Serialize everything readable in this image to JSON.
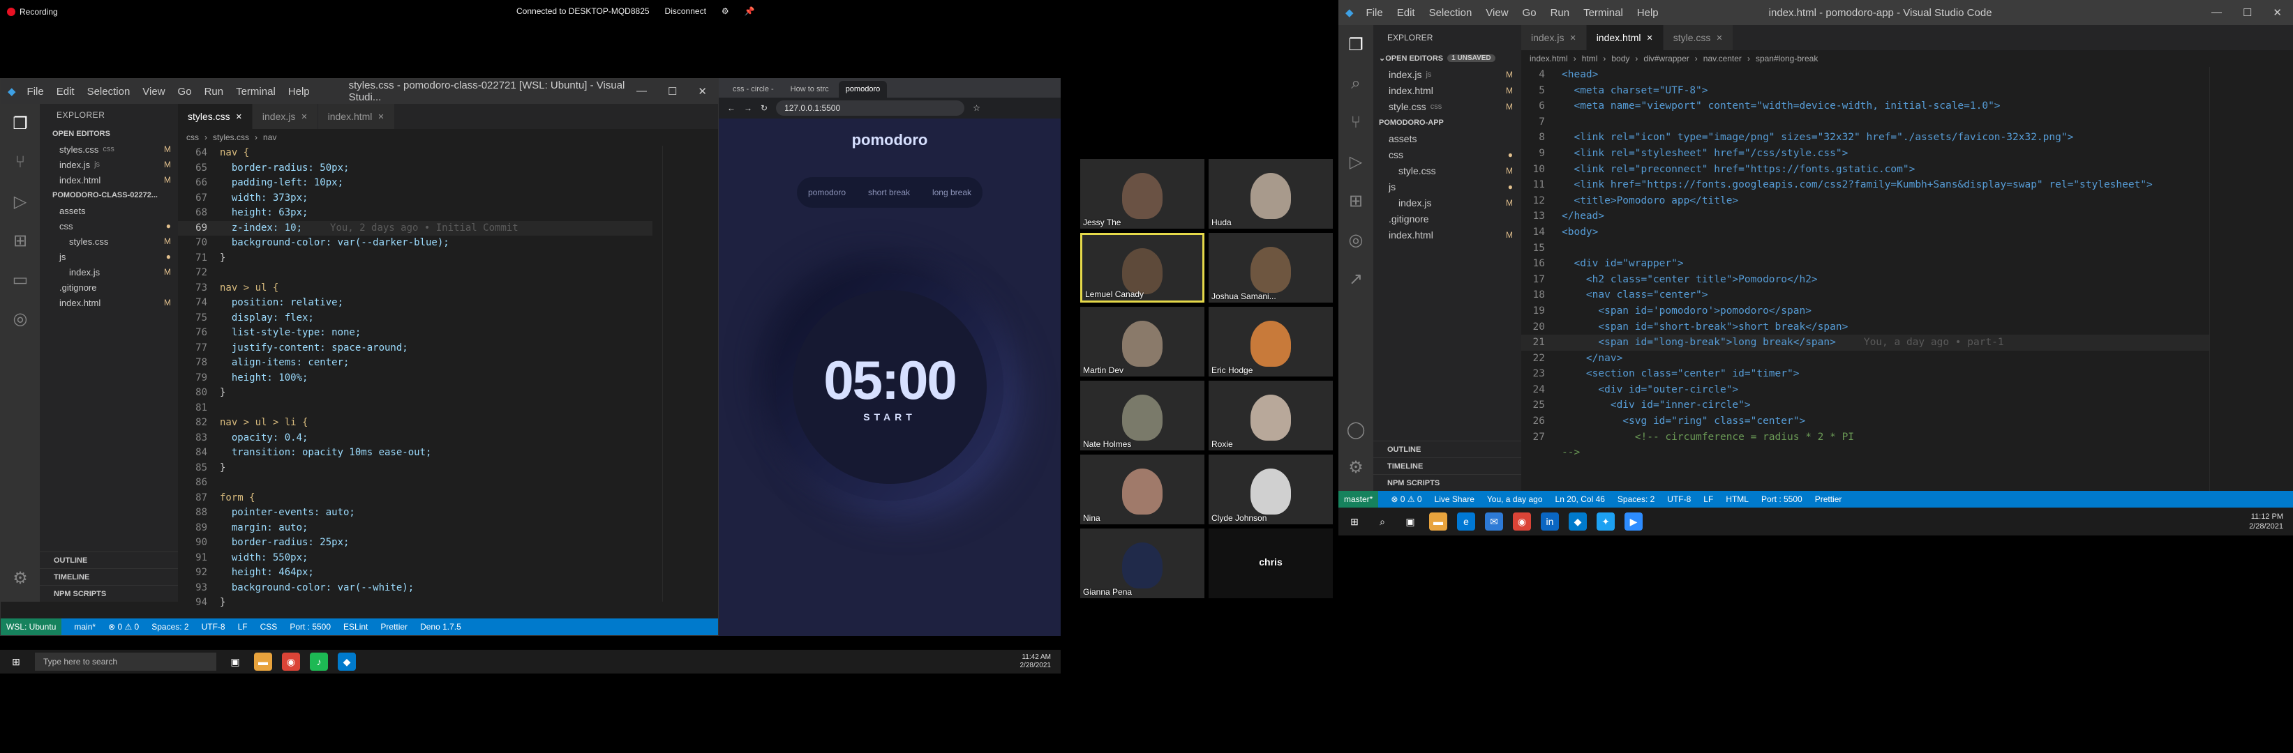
{
  "top": {
    "recording": "Recording",
    "connected": "Connected to DESKTOP-MQD8825",
    "disconnect": "Disconnect"
  },
  "left_vscode": {
    "menu": [
      "File",
      "Edit",
      "Selection",
      "View",
      "Go",
      "Run",
      "Terminal",
      "Help"
    ],
    "title": "styles.css - pomodoro-class-022721 [WSL: Ubuntu] - Visual Studi...",
    "explorer": "EXPLORER",
    "open_editors": "OPEN EDITORS",
    "open_files": [
      {
        "name": "styles.css",
        "path": "css",
        "status": "M"
      },
      {
        "name": "index.js",
        "path": "js",
        "status": "M"
      },
      {
        "name": "index.html",
        "path": "",
        "status": "M"
      }
    ],
    "project": "POMODORO-CLASS-02272...",
    "tree": [
      {
        "name": "assets",
        "status": ""
      },
      {
        "name": "css",
        "status": "●"
      },
      {
        "name": "styles.css",
        "status": "M"
      },
      {
        "name": "js",
        "status": "●"
      },
      {
        "name": "index.js",
        "status": "M"
      },
      {
        "name": ".gitignore",
        "status": ""
      },
      {
        "name": "index.html",
        "status": "M"
      }
    ],
    "bottom_sections": [
      "OUTLINE",
      "TIMELINE",
      "NPM SCRIPTS"
    ],
    "tabs": [
      "styles.css",
      "index.js",
      "index.html"
    ],
    "breadcrumb": [
      "css",
      "styles.css",
      "nav"
    ],
    "lines": [
      [
        "64",
        "nav {"
      ],
      [
        "65",
        "  border-radius: 50px;"
      ],
      [
        "66",
        "  padding-left: 10px;"
      ],
      [
        "67",
        "  width: 373px;"
      ],
      [
        "68",
        "  height: 63px;"
      ],
      [
        "69",
        "  z-index: 10;"
      ],
      [
        "70",
        "  background-color: var(--darker-blue);"
      ],
      [
        "71",
        "}"
      ],
      [
        "72",
        ""
      ],
      [
        "73",
        "nav > ul {"
      ],
      [
        "74",
        "  position: relative;"
      ],
      [
        "75",
        "  display: flex;"
      ],
      [
        "76",
        "  list-style-type: none;"
      ],
      [
        "77",
        "  justify-content: space-around;"
      ],
      [
        "78",
        "  align-items: center;"
      ],
      [
        "79",
        "  height: 100%;"
      ],
      [
        "80",
        "}"
      ],
      [
        "81",
        ""
      ],
      [
        "82",
        "nav > ul > li {"
      ],
      [
        "83",
        "  opacity: 0.4;"
      ],
      [
        "84",
        "  transition: opacity 10ms ease-out;"
      ],
      [
        "85",
        "}"
      ],
      [
        "86",
        ""
      ],
      [
        "87",
        "form {"
      ],
      [
        "88",
        "  pointer-events: auto;"
      ],
      [
        "89",
        "  margin: auto;"
      ],
      [
        "90",
        "  border-radius: 25px;"
      ],
      [
        "91",
        "  width: 550px;"
      ],
      [
        "92",
        "  height: 464px;"
      ],
      [
        "93",
        "  background-color: var(--white);"
      ],
      [
        "94",
        "}"
      ]
    ],
    "blame": "You, 2 days ago • Initial Commit",
    "status": [
      "WSL: Ubuntu",
      "main*",
      "⊗ 0 ⚠ 0",
      "Spaces: 2",
      "UTF-8",
      "LF",
      "CSS",
      "Port : 5500",
      "ESLint",
      "Prettier",
      "Deno 1.7.5"
    ]
  },
  "browser": {
    "tabs": [
      "css - circle -",
      "How to strc",
      "pomodoro"
    ],
    "url": "127.0.0.1:5500",
    "app_title": "pomodoro",
    "nav": [
      "pomodoro",
      "short break",
      "long break"
    ],
    "time": "05:00",
    "start": "START"
  },
  "participants": [
    "Jessy The",
    "Huda",
    "Lemuel Canady",
    "Joshua Samani...",
    "Martin Dev",
    "Eric Hodge",
    "Nate Holmes",
    "Roxie",
    "Nina",
    "Clyde Johnson",
    "Gianna Pena",
    "chris"
  ],
  "right_vscode": {
    "menu": [
      "File",
      "Edit",
      "Selection",
      "View",
      "Go",
      "Run",
      "Terminal",
      "Help"
    ],
    "title": "index.html - pomodoro-app - Visual Studio Code",
    "explorer": "EXPLORER",
    "open_editors": "OPEN EDITORS",
    "unsaved": "1 UNSAVED",
    "open_files": [
      {
        "name": "index.js",
        "path": "js",
        "status": "M"
      },
      {
        "name": "index.html",
        "path": "",
        "status": "M"
      },
      {
        "name": "style.css",
        "path": "css",
        "status": "M"
      }
    ],
    "project": "POMODORO-APP",
    "tree": [
      {
        "name": "assets",
        "status": ""
      },
      {
        "name": "css",
        "status": "●"
      },
      {
        "name": "style.css",
        "status": "M"
      },
      {
        "name": "js",
        "status": "●"
      },
      {
        "name": "index.js",
        "status": "M"
      },
      {
        "name": ".gitignore",
        "status": ""
      },
      {
        "name": "index.html",
        "status": "M"
      }
    ],
    "bottom_sections": [
      "OUTLINE",
      "TIMELINE",
      "NPM SCRIPTS"
    ],
    "tabs": [
      "index.js",
      "index.html",
      "style.css"
    ],
    "breadcrumb": [
      "index.html",
      "html",
      "body",
      "div#wrapper",
      "nav.center",
      "span#long-break"
    ],
    "blame": "You, a day ago • part-1",
    "status": [
      "master*",
      "⊗ 0 ⚠ 0",
      "Live Share",
      "You, a day ago",
      "Ln 20, Col 46",
      "Spaces: 2",
      "UTF-8",
      "LF",
      "HTML",
      "Port : 5500",
      "Prettier"
    ],
    "time": "11:12 PM",
    "date": "2/28/2021"
  },
  "left_taskbar": {
    "search": "Type here to search",
    "time": "11:42 AM",
    "date": "2/28/2021"
  }
}
